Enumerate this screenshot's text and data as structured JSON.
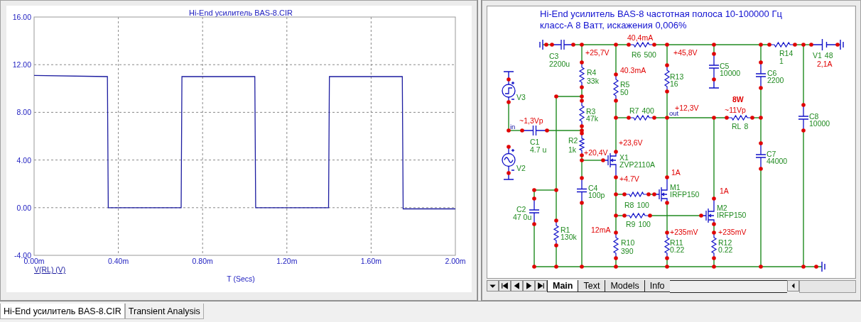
{
  "plot_window": {
    "chart_data": {
      "type": "line",
      "title": "Hi-End усилитель BAS-8.CIR",
      "xlabel": "T (Secs)",
      "x": [
        0,
        0.348,
        0.352,
        0.698,
        0.702,
        1.048,
        1.052,
        1.398,
        1.402,
        1.748,
        1.752,
        2
      ],
      "series": [
        {
          "name": "V(RL) (V)",
          "color": "#1c1ca0",
          "values": [
            11.1,
            11.0,
            0,
            0,
            11.0,
            11.0,
            0,
            0,
            11.0,
            11.0,
            -0.1,
            -0.1
          ]
        }
      ],
      "grid": true,
      "xlim": [
        0,
        2
      ],
      "ylim": [
        -4,
        16
      ],
      "xticks": [
        {
          "value": 0,
          "label": "0.00m"
        },
        {
          "value": 0.4,
          "label": "0.40m"
        },
        {
          "value": 0.8,
          "label": "0.80m"
        },
        {
          "value": 1.2,
          "label": "1.20m"
        },
        {
          "value": 1.6,
          "label": "1.60m"
        },
        {
          "value": 2,
          "label": "2.00m"
        }
      ],
      "yticks": [
        {
          "value": 16,
          "label": "16.00"
        },
        {
          "value": 12,
          "label": "12.00"
        },
        {
          "value": 8,
          "label": "8.00"
        },
        {
          "value": 4,
          "label": "4.00"
        },
        {
          "value": 0,
          "label": "0.00"
        },
        {
          "value": -4,
          "label": "-4.00"
        }
      ]
    }
  },
  "schematic_window": {
    "title_lines": [
      "Hi-End усилитель BAS-8 частотная полоса 10-100000 Гц",
      "класс-А 8 Ватт, искажения 0,006%"
    ],
    "components": [
      {
        "name": "C3",
        "value": "2200u",
        "kind": "capacitor"
      },
      {
        "name": "R6",
        "value": "500",
        "kind": "resistor"
      },
      {
        "name": "R14",
        "value": "1",
        "kind": "resistor"
      },
      {
        "name": "V1",
        "value": "48",
        "kind": "battery"
      },
      {
        "name": "R4",
        "value": "33k",
        "kind": "resistor"
      },
      {
        "name": "R5",
        "value": "50",
        "kind": "resistor"
      },
      {
        "name": "R13",
        "value": "16",
        "kind": "resistor"
      },
      {
        "name": "C5",
        "value": "10000",
        "kind": "capacitor"
      },
      {
        "name": "C6",
        "value": "2200",
        "kind": "capacitor"
      },
      {
        "name": "V3",
        "kind": "pulse_source"
      },
      {
        "name": "R3",
        "value": "47k",
        "kind": "resistor"
      },
      {
        "name": "R7",
        "value": "400",
        "kind": "resistor"
      },
      {
        "name": "RL",
        "value": "8",
        "kind": "resistor"
      },
      {
        "name": "C8",
        "value": "10000",
        "kind": "capacitor"
      },
      {
        "name": "C1",
        "value": "4.7 u",
        "kind": "capacitor"
      },
      {
        "name": "R2",
        "value": "1k",
        "kind": "resistor"
      },
      {
        "name": "X1",
        "value": "ZVP2110A",
        "kind": "mosfet"
      },
      {
        "name": "V2",
        "kind": "sine_source"
      },
      {
        "name": "C7",
        "value": "44000",
        "kind": "capacitor"
      },
      {
        "name": "C4",
        "value": "100p",
        "kind": "capacitor"
      },
      {
        "name": "M1",
        "value": "IRFP150",
        "kind": "mosfet"
      },
      {
        "name": "R8",
        "value": "100",
        "kind": "resistor"
      },
      {
        "name": "C2",
        "value": "47 0u",
        "kind": "capacitor"
      },
      {
        "name": "M2",
        "value": "IRFP150",
        "kind": "mosfet"
      },
      {
        "name": "R9",
        "value": "100",
        "kind": "resistor"
      },
      {
        "name": "R1",
        "value": "130k",
        "kind": "resistor"
      },
      {
        "name": "R10",
        "value": "390",
        "kind": "resistor"
      },
      {
        "name": "R11",
        "value": "0.22",
        "kind": "resistor"
      },
      {
        "name": "R12",
        "value": "0.22",
        "kind": "resistor"
      }
    ],
    "annotations": [
      {
        "text": "40,4mA",
        "kind": "reading"
      },
      {
        "text": "+25,7V",
        "kind": "reading"
      },
      {
        "text": "+45,8V",
        "kind": "reading"
      },
      {
        "text": "2,1A",
        "kind": "reading"
      },
      {
        "text": "40.3mA",
        "kind": "reading"
      },
      {
        "text": "8W",
        "kind": "power"
      },
      {
        "text": "+12,3V",
        "kind": "reading"
      },
      {
        "text": "~11Vp",
        "kind": "reading"
      },
      {
        "text": "~1,3Vp",
        "kind": "reading"
      },
      {
        "text": "+23,6V",
        "kind": "reading"
      },
      {
        "text": "+20,4V",
        "kind": "reading"
      },
      {
        "text": "1A",
        "kind": "reading"
      },
      {
        "text": "+4.7V",
        "kind": "reading"
      },
      {
        "text": "1A",
        "kind": "reading"
      },
      {
        "text": "12mA",
        "kind": "reading"
      },
      {
        "text": "+235mV",
        "kind": "reading"
      },
      {
        "text": "+235mV",
        "kind": "reading"
      }
    ],
    "node_labels": [
      "out",
      "in"
    ],
    "sheet_tabs": [
      {
        "label": "Main",
        "selected": true
      },
      {
        "label": "Text",
        "selected": false
      },
      {
        "label": "Models",
        "selected": false
      },
      {
        "label": "Info",
        "selected": false
      }
    ]
  },
  "document_tabs": [
    {
      "label": "Hi-End усилитель BAS-8.CIR",
      "selected": true
    },
    {
      "label": "Transient Analysis",
      "selected": false
    }
  ]
}
